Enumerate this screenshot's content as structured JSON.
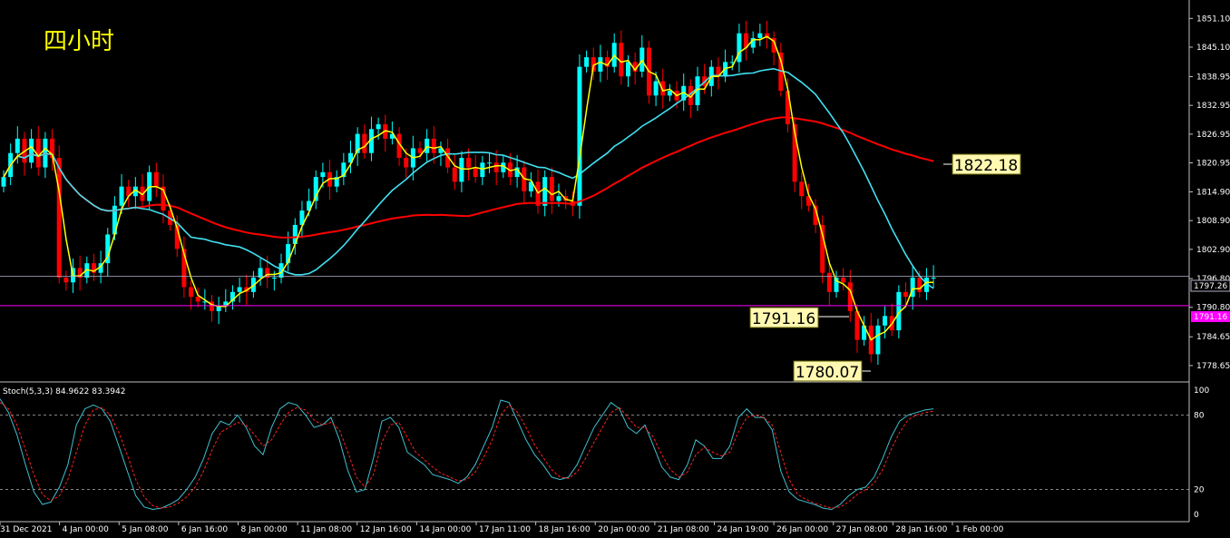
{
  "chart_data": [
    {
      "type": "candlestick",
      "title": "四小时",
      "ylim": [
        1775.6,
        1854.0
      ],
      "y_ticks": [
        "1851.10",
        "1845.10",
        "1838.95",
        "1832.95",
        "1826.95",
        "1820.95",
        "1814.90",
        "1808.90",
        "1802.90",
        "1796.80",
        "1790.80",
        "1784.65",
        "1778.65"
      ],
      "x_ticks": [
        "31 Dec 2021",
        "4 Jan 00:00",
        "5 Jan 08:00",
        "6 Jan 16:00",
        "8 Jan 00:00",
        "11 Jan 08:00",
        "12 Jan 16:00",
        "14 Jan 00:00",
        "17 Jan 11:00",
        "18 Jan 16:00",
        "20 Jan 00:00",
        "21 Jan 08:00",
        "24 Jan 19:00",
        "26 Jan 00:00",
        "27 Jan 08:00",
        "28 Jan 16:00",
        "1 Feb 00:00"
      ],
      "current_price": "1797.26",
      "level_line": "1791.16",
      "annotations": [
        {
          "text": "1822.18"
        },
        {
          "text": "1791.16"
        },
        {
          "text": "1780.07"
        }
      ],
      "colors": {
        "up": "#00ffff",
        "down": "#ff0000",
        "fast_ma": "#ffff00",
        "mid_ma": "#40e0f0",
        "slow_ma": "#ff0000",
        "level": "#ff00ff",
        "price_line": "#b0b0c8"
      },
      "closes": [
        1818,
        1823,
        1826,
        1821,
        1826,
        1820,
        1826,
        1822,
        1797,
        1796,
        1799,
        1797,
        1800,
        1798,
        1800,
        1806,
        1812,
        1816,
        1814,
        1816,
        1813,
        1819,
        1816,
        1811,
        1808,
        1803,
        1795,
        1793,
        1792,
        1792,
        1790,
        1791,
        1792,
        1794,
        1795,
        1794,
        1797,
        1799,
        1797,
        1797,
        1800,
        1804,
        1808,
        1811,
        1813,
        1818,
        1819,
        1816,
        1818,
        1821,
        1823,
        1827,
        1823,
        1828,
        1829,
        1826,
        1827,
        1822,
        1820,
        1824,
        1823,
        1826,
        1823,
        1824,
        1820,
        1817,
        1822,
        1820,
        1818,
        1821,
        1821,
        1819,
        1821,
        1818,
        1820,
        1815,
        1817,
        1812,
        1818,
        1813,
        1814,
        1813,
        1812,
        1841,
        1843,
        1840,
        1843,
        1841,
        1846,
        1839,
        1842,
        1840,
        1845,
        1835,
        1838,
        1835,
        1836,
        1834,
        1837,
        1833,
        1839,
        1837,
        1841,
        1839,
        1842,
        1842,
        1848,
        1845,
        1847,
        1848,
        1847,
        1844,
        1836,
        1829,
        1817,
        1814,
        1812,
        1808,
        1798,
        1794,
        1797,
        1796,
        1790,
        1784,
        1787,
        1781,
        1787,
        1789,
        1786,
        1794,
        1793,
        1797,
        1794,
        1797,
        1797
      ],
      "stoch_ylim": [
        0,
        100
      ],
      "stoch_levels": [
        80,
        20
      ],
      "stoch_ticks": [
        "100",
        "80",
        "20",
        "0"
      ],
      "stoch_header": "Stoch(5,3,3) 84.9622 83.3942",
      "stoch_k": [
        93,
        82,
        64,
        40,
        18,
        8,
        10,
        22,
        40,
        72,
        85,
        88,
        85,
        75,
        55,
        35,
        15,
        6,
        4,
        5,
        8,
        12,
        20,
        30,
        45,
        65,
        75,
        72,
        80,
        70,
        55,
        48,
        70,
        85,
        90,
        88,
        80,
        70,
        72,
        78,
        60,
        35,
        18,
        20,
        45,
        75,
        78,
        70,
        50,
        45,
        40,
        32,
        30,
        28,
        25,
        30,
        40,
        55,
        70,
        92,
        90,
        75,
        60,
        48,
        40,
        30,
        28,
        30,
        40,
        55,
        70,
        80,
        90,
        85,
        70,
        65,
        72,
        55,
        38,
        30,
        28,
        40,
        60,
        55,
        45,
        45,
        55,
        78,
        85,
        78,
        78,
        68,
        35,
        18,
        12,
        10,
        8,
        5,
        4,
        8,
        15,
        20,
        22,
        30,
        45,
        62,
        75,
        80,
        82,
        84,
        85
      ],
      "stoch_d": [
        90,
        85,
        72,
        52,
        32,
        16,
        11,
        15,
        28,
        50,
        72,
        84,
        86,
        80,
        66,
        48,
        28,
        14,
        7,
        5,
        6,
        9,
        14,
        22,
        35,
        52,
        66,
        70,
        74,
        72,
        64,
        55,
        60,
        72,
        82,
        86,
        84,
        76,
        72,
        74,
        68,
        50,
        30,
        22,
        32,
        58,
        72,
        74,
        62,
        50,
        44,
        38,
        33,
        30,
        27,
        28,
        34,
        46,
        60,
        80,
        88,
        82,
        70,
        56,
        46,
        36,
        30,
        29,
        34,
        45,
        58,
        70,
        82,
        86,
        78,
        70,
        70,
        62,
        48,
        36,
        30,
        34,
        48,
        54,
        50,
        47,
        50,
        66,
        78,
        80,
        78,
        72,
        50,
        28,
        16,
        12,
        9,
        7,
        5,
        6,
        10,
        16,
        20,
        25,
        36,
        52,
        66,
        76,
        80,
        82,
        83
      ]
    }
  ]
}
